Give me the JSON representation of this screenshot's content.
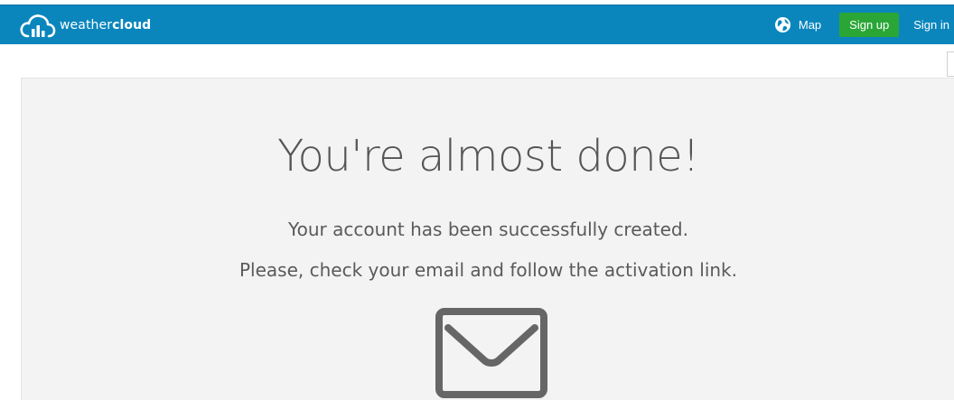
{
  "navbar": {
    "logo": {
      "text_light": "weather",
      "text_bold": "cloud",
      "icon": "cloud-bars-icon"
    },
    "map_label": "Map",
    "map_icon": "globe-icon",
    "signup_label": "Sign up",
    "signin_label": "Sign in"
  },
  "main": {
    "headline": "You're almost done!",
    "line1": "Your account has been successfully created.",
    "line2": "Please, check your email and follow the activation link.",
    "icon": "envelope-icon"
  },
  "colors": {
    "navbar": "#0a86bd",
    "signup_button": "#2aa637",
    "panel": "#f3f3f3",
    "text": "#555555"
  }
}
